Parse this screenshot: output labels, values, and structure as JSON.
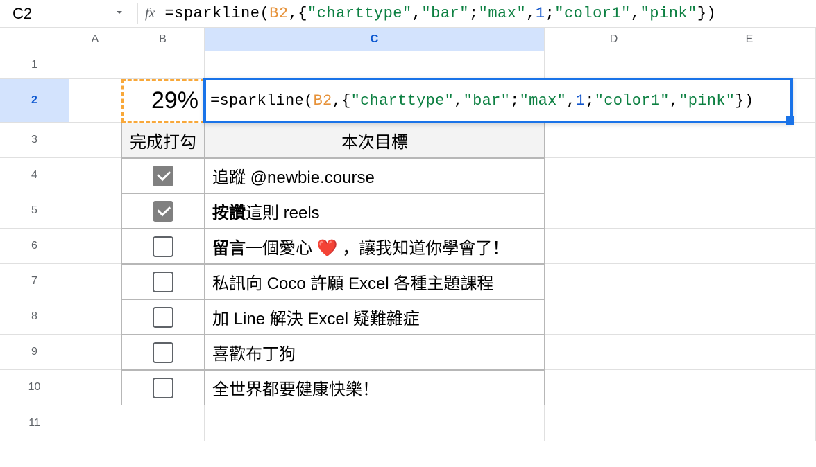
{
  "nameBox": "C2",
  "formula": {
    "prefix": "=sparkline",
    "open": "(",
    "ref": "B2",
    "comma1": ",{",
    "str1": "\"charttype\"",
    "comma2": ",",
    "str2": "\"bar\"",
    "semi1": ";",
    "str3": "\"max\"",
    "comma3": ",",
    "num1": "1",
    "semi2": ";",
    "str4": "\"color1\"",
    "comma4": ",",
    "str5": "\"pink\"",
    "close": "})"
  },
  "columns": [
    "A",
    "B",
    "C",
    "D",
    "E"
  ],
  "rows": [
    "1",
    "2",
    "3",
    "4",
    "5",
    "6",
    "7",
    "8",
    "9",
    "10",
    "11"
  ],
  "b2": "29%",
  "headers": {
    "b3": "完成打勾",
    "c3": "本次目標"
  },
  "tasks": [
    {
      "checked": true,
      "text": "追蹤 @newbie.course"
    },
    {
      "checked": true,
      "textPrefix": "按讚",
      "textRest": "這則 reels"
    },
    {
      "checked": false,
      "textPrefix": "留言",
      "textRest": "一個愛心 ❤️ ，讓我知道你學會了！"
    },
    {
      "checked": false,
      "text": "私訊向 Coco 許願 Excel 各種主題課程"
    },
    {
      "checked": false,
      "text": "加 Line 解決 Excel 疑難雜症"
    },
    {
      "checked": false,
      "text": "喜歡布丁狗"
    },
    {
      "checked": false,
      "text": "全世界都要健康快樂！"
    }
  ]
}
